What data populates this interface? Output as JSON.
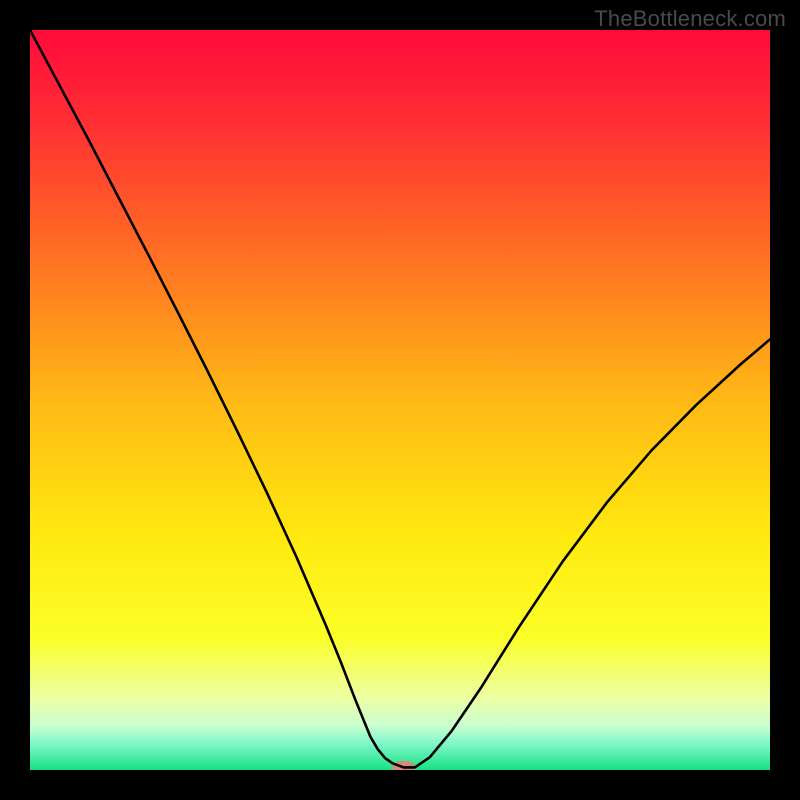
{
  "watermark": "TheBottleneck.com",
  "chart_data": {
    "type": "line",
    "title": "",
    "xlabel": "",
    "ylabel": "",
    "xlim": [
      0,
      100
    ],
    "ylim": [
      0,
      100
    ],
    "grid": false,
    "legend": false,
    "background": {
      "type": "vertical-gradient",
      "stops": [
        {
          "pos": 0.0,
          "color": "#ff0a3b"
        },
        {
          "pos": 0.12,
          "color": "#ff2d34"
        },
        {
          "pos": 0.3,
          "color": "#ff6e24"
        },
        {
          "pos": 0.5,
          "color": "#ffb916"
        },
        {
          "pos": 0.68,
          "color": "#ffe80f"
        },
        {
          "pos": 0.82,
          "color": "#fbff27"
        },
        {
          "pos": 0.9,
          "color": "#eeffa0"
        },
        {
          "pos": 0.94,
          "color": "#c9ffd0"
        },
        {
          "pos": 0.965,
          "color": "#7ef7c8"
        },
        {
          "pos": 1.0,
          "color": "#17e184"
        }
      ]
    },
    "series": [
      {
        "name": "curve",
        "color": "#000000",
        "stroke_width": 2.6,
        "x": [
          0,
          4,
          8,
          12,
          16,
          20,
          24,
          28,
          32,
          36,
          40,
          42,
          44,
          46,
          47,
          48,
          49,
          50.5,
          52,
          54,
          57,
          61,
          66,
          72,
          78,
          84,
          90,
          96,
          100
        ],
        "y": [
          100,
          92.5,
          85,
          77.3,
          69.6,
          61.8,
          53.9,
          45.8,
          37.5,
          28.8,
          19.5,
          14.6,
          9.4,
          4.5,
          2.8,
          1.6,
          0.9,
          0.35,
          0.35,
          1.7,
          5.3,
          11.2,
          19.2,
          28.2,
          36.2,
          43.2,
          49.3,
          54.8,
          58.2
        ]
      }
    ],
    "marker": {
      "name": "minimum-marker",
      "x": 50.5,
      "y": 0.35,
      "rx": 1.6,
      "ry": 0.9,
      "color": "#d58b7a"
    }
  }
}
